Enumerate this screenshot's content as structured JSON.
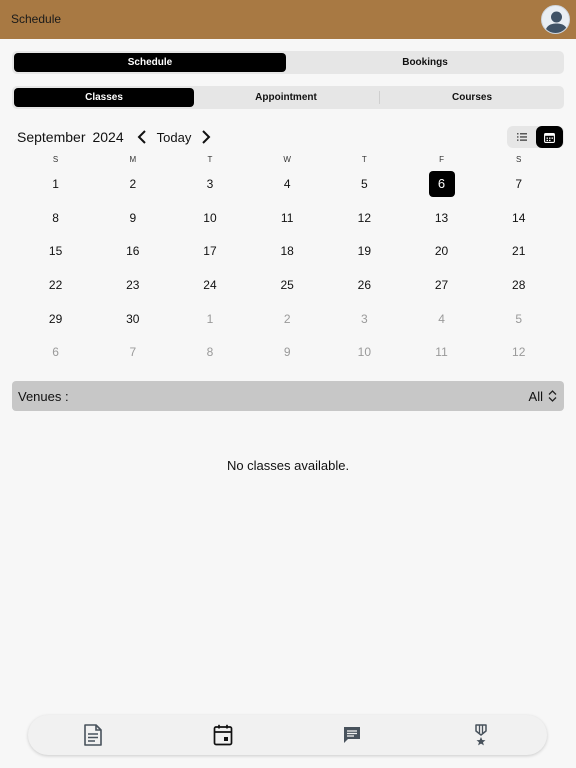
{
  "header": {
    "title": "Schedule",
    "avatar": "user-avatar-icon"
  },
  "top_tabs": [
    {
      "label": "Schedule",
      "active": true
    },
    {
      "label": "Bookings",
      "active": false
    }
  ],
  "sub_tabs": [
    {
      "label": "Classes",
      "active": true
    },
    {
      "label": "Appointment",
      "active": false
    },
    {
      "label": "Courses",
      "active": false
    }
  ],
  "calendar": {
    "month": "September",
    "year": "2024",
    "today_label": "Today",
    "weekdays": [
      "S",
      "M",
      "T",
      "W",
      "T",
      "F",
      "S"
    ],
    "weeks": [
      [
        "1",
        "2",
        "3",
        "4",
        "5",
        "6",
        "7"
      ],
      [
        "8",
        "9",
        "10",
        "11",
        "12",
        "13",
        "14"
      ],
      [
        "15",
        "16",
        "17",
        "18",
        "19",
        "20",
        "21"
      ],
      [
        "22",
        "23",
        "24",
        "25",
        "26",
        "27",
        "28"
      ],
      [
        "29",
        "30",
        "1",
        "2",
        "3",
        "4",
        "5"
      ],
      [
        "6",
        "7",
        "8",
        "9",
        "10",
        "11",
        "12"
      ]
    ],
    "selected_day": "6",
    "view_modes": [
      "list-view-icon",
      "calendar-view-icon"
    ],
    "active_view": "calendar-view-icon"
  },
  "venues": {
    "label": "Venues :",
    "value": "All"
  },
  "empty_message": "No classes available.",
  "bottom_nav": [
    "document-icon",
    "calendar-icon",
    "chat-icon",
    "medal-icon"
  ],
  "colors": {
    "header": "#a87943",
    "selected": "#000000",
    "segment_bg": "#e6e6e6",
    "venues_bg": "#c7c7c7",
    "muted_day": "#9a9a9a"
  }
}
